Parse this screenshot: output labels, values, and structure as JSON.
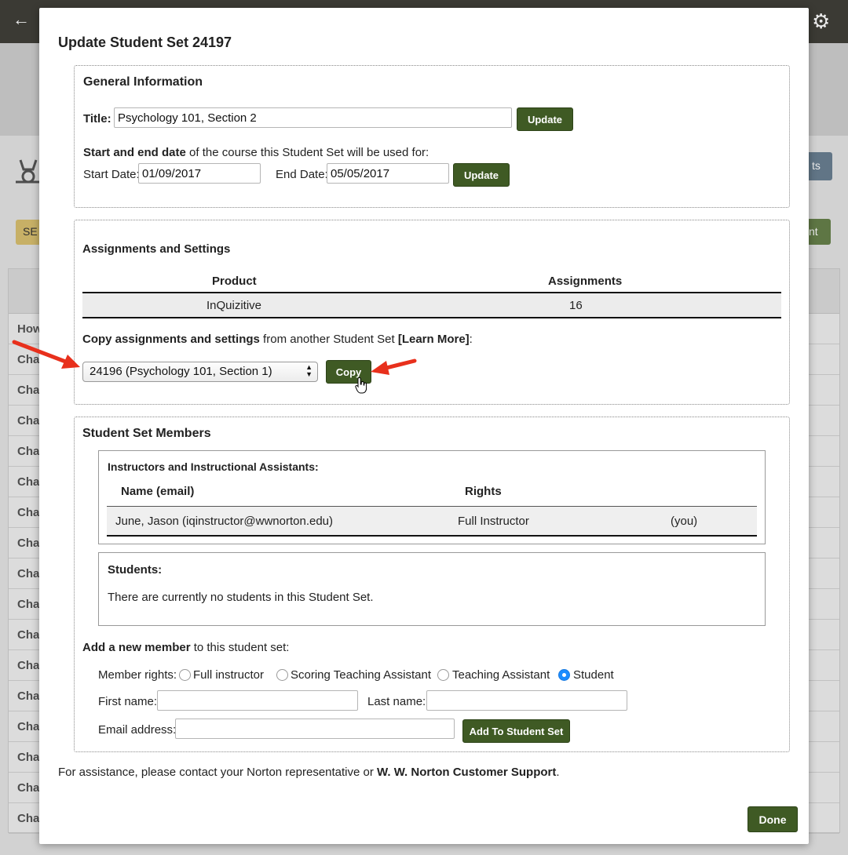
{
  "background": {
    "back_icon": "arrow-left-icon",
    "settings_icon": "gear-icon",
    "sections_badge": "SE",
    "right_button_1": "ts",
    "right_button_2": "nt",
    "row_header": "How",
    "row_label": "Cha"
  },
  "modal": {
    "title": "Update Student Set 24197",
    "general": {
      "heading": "General Information",
      "title_label": "Title:",
      "title_value": "Psychology 101, Section 2",
      "title_update": "Update",
      "dates_intro_bold": "Start and end date",
      "dates_intro_rest": " of the course this Student Set will be used for:",
      "start_label": "Start Date:",
      "start_value": "01/09/2017",
      "end_label": "End Date:",
      "end_value": "05/05/2017",
      "dates_update": "Update"
    },
    "assignments": {
      "heading": "Assignments and Settings",
      "col_product": "Product",
      "col_assignments": "Assignments",
      "row_product": "InQuizitive",
      "row_assignments": "16",
      "copy_bold": "Copy assignments and settings",
      "copy_rest": " from another Student Set ",
      "learn_more": "[Learn More]",
      "copy_colon": ":",
      "select_value": "24196 (Psychology 101, Section 1)",
      "copy_button": "Copy"
    },
    "members": {
      "heading": "Student Set Members",
      "instructors_heading": "Instructors and Instructional Assistants:",
      "col_name": "Name (email)",
      "col_rights": "Rights",
      "instructor_name": "June, Jason (iqinstructor@wwnorton.edu)",
      "instructor_rights": "Full Instructor",
      "instructor_you": "(you)",
      "students_heading": "Students:",
      "students_empty": "There are currently no students in this Student Set.",
      "add_bold": "Add a new member",
      "add_rest": " to this student set:",
      "rights_label": "Member rights:",
      "rights_options": [
        "Full instructor",
        "Scoring Teaching Assistant",
        "Teaching Assistant",
        "Student"
      ],
      "rights_selected": "Student",
      "first_name_label": "First name:",
      "last_name_label": "Last name:",
      "email_label": "Email address:",
      "add_button": "Add To Student Set"
    },
    "assistance_text": "For assistance, please contact your Norton representative or ",
    "assistance_link": "W. W. Norton Customer Support",
    "assistance_end": ".",
    "done_button": "Done"
  },
  "colors": {
    "button_green": "#3f5a24",
    "annotation_arrow": "#e8301c",
    "radio_selected": "#1a8cff"
  }
}
